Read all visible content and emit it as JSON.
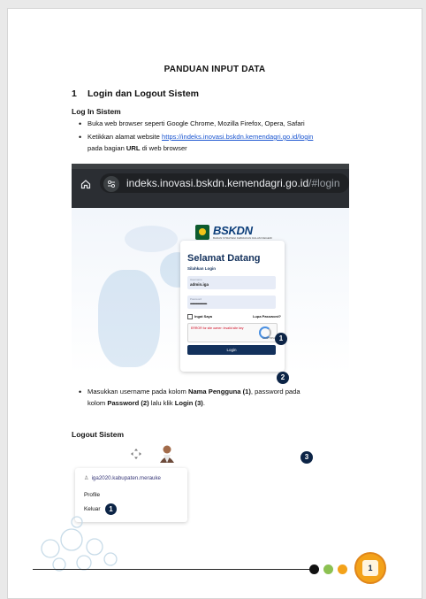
{
  "doc": {
    "title": "PANDUAN INPUT DATA",
    "section_num": "1",
    "section_title": "Login dan Logout Sistem",
    "login_heading": "Log In Sistem",
    "bullet1": "Buka web browser seperti Google Chrome, Mozilla Firefox, Opera, Safari",
    "bullet2_pre": "Ketikkan alamat website ",
    "bullet2_link": "https://indeks.inovasi.bskdn.kemendagri.go.id/login",
    "bullet2_line2_pre": "pada bagian ",
    "bullet2_bold": "URL",
    "bullet2_line2_post": " di web browser",
    "bullet3_pre": "Masukkan username pada kolom ",
    "bullet3_b1": "Nama Pengguna (1)",
    "bullet3_mid": ", password pada",
    "bullet3_line2_pre": "kolom ",
    "bullet3_b2": "Password (2)",
    "bullet3_mid2": " lalu klik ",
    "bullet3_b3": "Login (3)",
    "bullet3_end": ".",
    "logout_heading": "Logout Sistem"
  },
  "browser": {
    "url_main": "indeks.inovasi.bskdn.kemendagri.go.id",
    "url_hash": "/#login",
    "home_icon": "home-icon",
    "tune_icon": "tune-icon"
  },
  "login_form": {
    "logo_text": "BSKDN",
    "logo_sub": "BADAN STRATEGI KEBIJAKAN DALAM NEGERI",
    "welcome": "Selamat Datang",
    "subtitle": "Silahkan Login",
    "username_label": "Username",
    "username_value": "admin.iga",
    "password_label": "Password",
    "password_value": "••••••••••••••••••••••••",
    "remember": "Ingat Saya",
    "forgot": "Lupa Password?",
    "captcha_error": "ERROR for site owner: Invalid site key",
    "captcha_brand": "reCAPTCHA",
    "login_button": "Login"
  },
  "badges": {
    "b1": "1",
    "b2": "2",
    "b3": "3",
    "keluar_badge": "1"
  },
  "logout_menu": {
    "user": "iga2020.kabupaten.merauke",
    "profile": "Profile",
    "logout": "Keluar"
  },
  "footer": {
    "page_number": "1"
  },
  "colors": {
    "navy": "#0c2446",
    "link": "#1a55d0",
    "dot_green": "#8cc152",
    "dot_orange": "#f3a21a"
  }
}
